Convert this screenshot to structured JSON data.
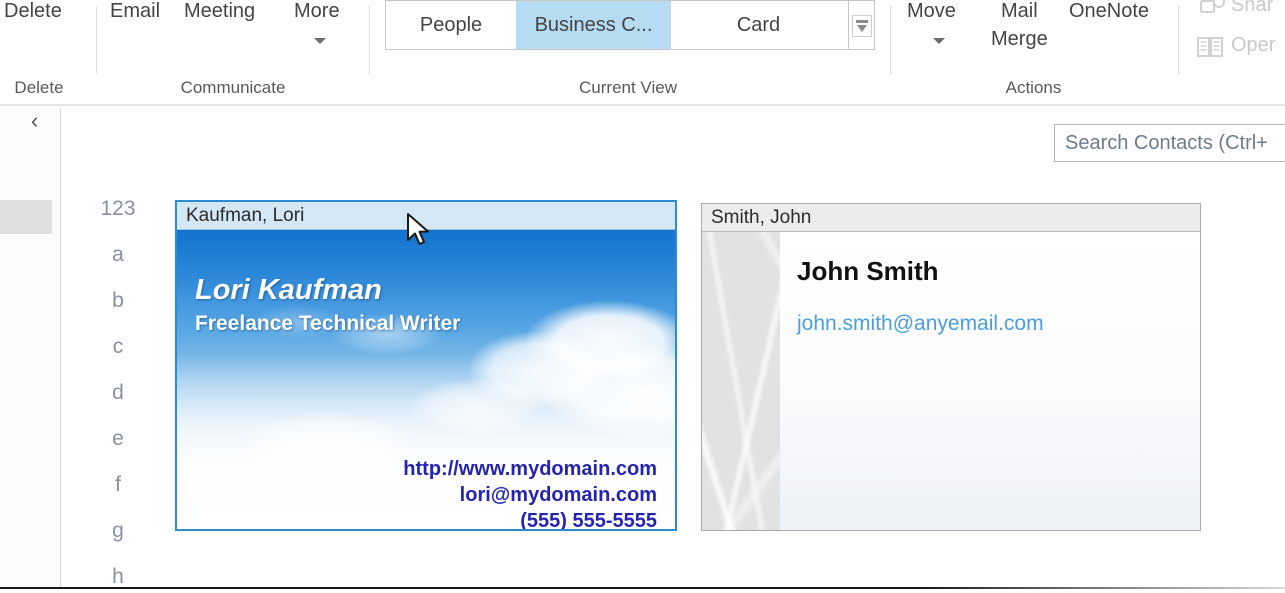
{
  "ribbon": {
    "groups": [
      {
        "label": "Delete"
      },
      {
        "label": "Communicate"
      },
      {
        "label": "Current View"
      },
      {
        "label": "Actions"
      }
    ],
    "delete_group": {
      "delete_button": "Delete"
    },
    "communicate_group": {
      "email_button": "Email",
      "meeting_button": "Meeting",
      "more_button": "More"
    },
    "current_view_group": {
      "gallery_items": [
        {
          "label": "People",
          "selected": false
        },
        {
          "label": "Business C...",
          "selected": true
        },
        {
          "label": "Card",
          "selected": false
        }
      ],
      "selected_highlight_color": "#b5dcf2"
    },
    "actions_group": {
      "move_button": "Move",
      "mail_merge_button": "Mail Merge",
      "mail_merge_line1": "Mail",
      "mail_merge_line2": "Merge",
      "onenote_button": "OneNote"
    },
    "share_group": {
      "share_button": "Shar",
      "open_button": "Oper"
    }
  },
  "navigation": {
    "collapse_chevron": "‹"
  },
  "search": {
    "placeholder": "Search Contacts (Ctrl+"
  },
  "alpha_index": {
    "items": [
      "123",
      "a",
      "b",
      "c",
      "d",
      "e",
      "f",
      "g",
      "h"
    ]
  },
  "cards": [
    {
      "id": "kaufman",
      "header": "Kaufman, Lori",
      "selected": true,
      "name": "Lori Kaufman",
      "title": "Freelance Technical Writer",
      "website": "http://www.mydomain.com",
      "email": "lori@mydomain.com",
      "phone": "(555) 555-5555",
      "accent_color": "#2e8bd0",
      "header_color": "#d3e7f5",
      "contact_text_color": "#2424b4"
    },
    {
      "id": "smith",
      "header": "Smith, John",
      "selected": false,
      "name": "John Smith",
      "email": "john.smith@anyemail.com",
      "header_color": "#ececec",
      "email_text_color": "#4a9fe0"
    }
  ]
}
